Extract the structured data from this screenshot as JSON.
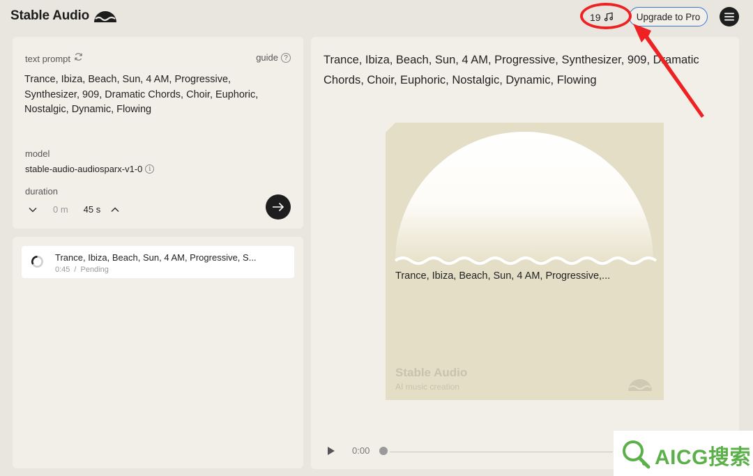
{
  "header": {
    "brand": "Stable Audio",
    "credits_count": "19",
    "upgrade_label": "Upgrade to Pro"
  },
  "prompt_panel": {
    "label": "text prompt",
    "guide_label": "guide",
    "guide_icon_text": "?",
    "prompt_text": "Trance, Ibiza, Beach, Sun, 4 AM, Progressive, Synthesizer, 909, Dramatic Chords, Choir, Euphoric, Nostalgic, Dynamic, Flowing",
    "model_label": "model",
    "model_value": "stable-audio-audiosparx-v1-0",
    "info_icon_text": "i",
    "duration_label": "duration",
    "duration_minutes": "0 m",
    "duration_seconds": "45 s"
  },
  "queue": {
    "items": [
      {
        "title": "Trance, Ibiza, Beach, Sun, 4 AM, Progressive, S...",
        "length": "0:45",
        "separator": "/",
        "status": "Pending"
      }
    ]
  },
  "main": {
    "title": "Trance, Ibiza, Beach, Sun, 4 AM, Progressive, Synthesizer, 909, Dramatic Chords, Choir, Euphoric, Nostalgic, Dynamic, Flowing",
    "artwork_caption": "Trance, Ibiza, Beach, Sun, 4 AM, Progressive,...",
    "artwork_brand": "Stable Audio",
    "artwork_subtitle": "AI music creation",
    "player_time": "0:00"
  },
  "watermark": {
    "text": "AICG搜索"
  },
  "colors": {
    "background": "#e9e6df",
    "panel": "#f2efe9",
    "artwork": "#e4dec7",
    "accent_blue": "#3a74d6",
    "annotation_red": "#ee2222",
    "watermark_green": "#5bb04a"
  }
}
